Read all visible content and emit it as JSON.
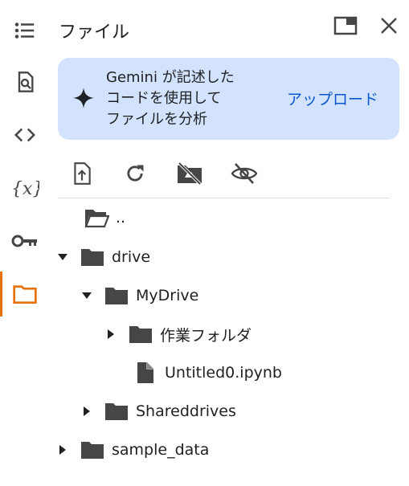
{
  "panel": {
    "title": "ファイル"
  },
  "icons": {
    "rail": [
      "table-of-contents-icon",
      "find-icon",
      "code-icon",
      "variables-icon",
      "key-icon",
      "folder-icon"
    ],
    "window": [
      "open-in-tab-icon",
      "close-icon"
    ],
    "toolbar": [
      "upload-file-icon",
      "refresh-icon",
      "disable-drive-icon",
      "hide-icon"
    ]
  },
  "banner": {
    "message": "Gemini が記述した\nコードを使用して\nファイルを分析",
    "action_label": "アップロード"
  },
  "tree": [
    {
      "label": "..",
      "expanded": null,
      "kind": "folder-open"
    },
    {
      "label": "drive",
      "expanded": true,
      "kind": "folder"
    },
    {
      "label": "MyDrive",
      "expanded": true,
      "kind": "folder"
    },
    {
      "label": "作業フォルダ",
      "expanded": false,
      "kind": "folder"
    },
    {
      "label": "Untitled0.ipynb",
      "expanded": null,
      "kind": "file"
    },
    {
      "label": "Shareddrives",
      "expanded": false,
      "kind": "folder"
    },
    {
      "label": "sample_data",
      "expanded": false,
      "kind": "folder"
    }
  ],
  "colors": {
    "accent": "#e8710a",
    "banner_bg": "#d3e3fd",
    "link": "#0b57d0",
    "icon": "#444746"
  }
}
